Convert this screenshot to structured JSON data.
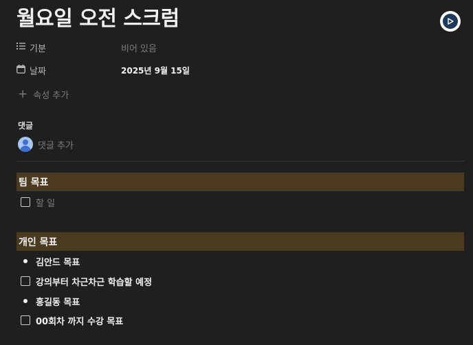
{
  "page": {
    "title": "월요일 오전 스크럼"
  },
  "properties": [
    {
      "icon": "list-icon",
      "key": "기분",
      "value": "비어 있음",
      "empty": true
    },
    {
      "icon": "calendar-icon",
      "key": "날짜",
      "value": "2025년 9월 15일",
      "empty": false
    }
  ],
  "add_property_label": "속성 추가",
  "comments": {
    "label": "댓글",
    "placeholder": "댓글 추가"
  },
  "sections": [
    {
      "heading": "팀 목표",
      "items": [
        {
          "type": "todo",
          "text": "할 일",
          "placeholder": true
        }
      ]
    },
    {
      "heading": "개인 목표",
      "items": [
        {
          "type": "bullet",
          "text": "김안드 목표"
        },
        {
          "type": "todo",
          "text": "강의부터 차근차근 학습할 예정"
        },
        {
          "type": "bullet",
          "text": "홍길동 목표"
        },
        {
          "type": "todo",
          "text": "00회차 까지 수강 목표"
        }
      ]
    }
  ],
  "colors": {
    "background": "#1f1f1f",
    "heading_highlight": "#4a3b20",
    "avatar": "#3f6fd1"
  }
}
